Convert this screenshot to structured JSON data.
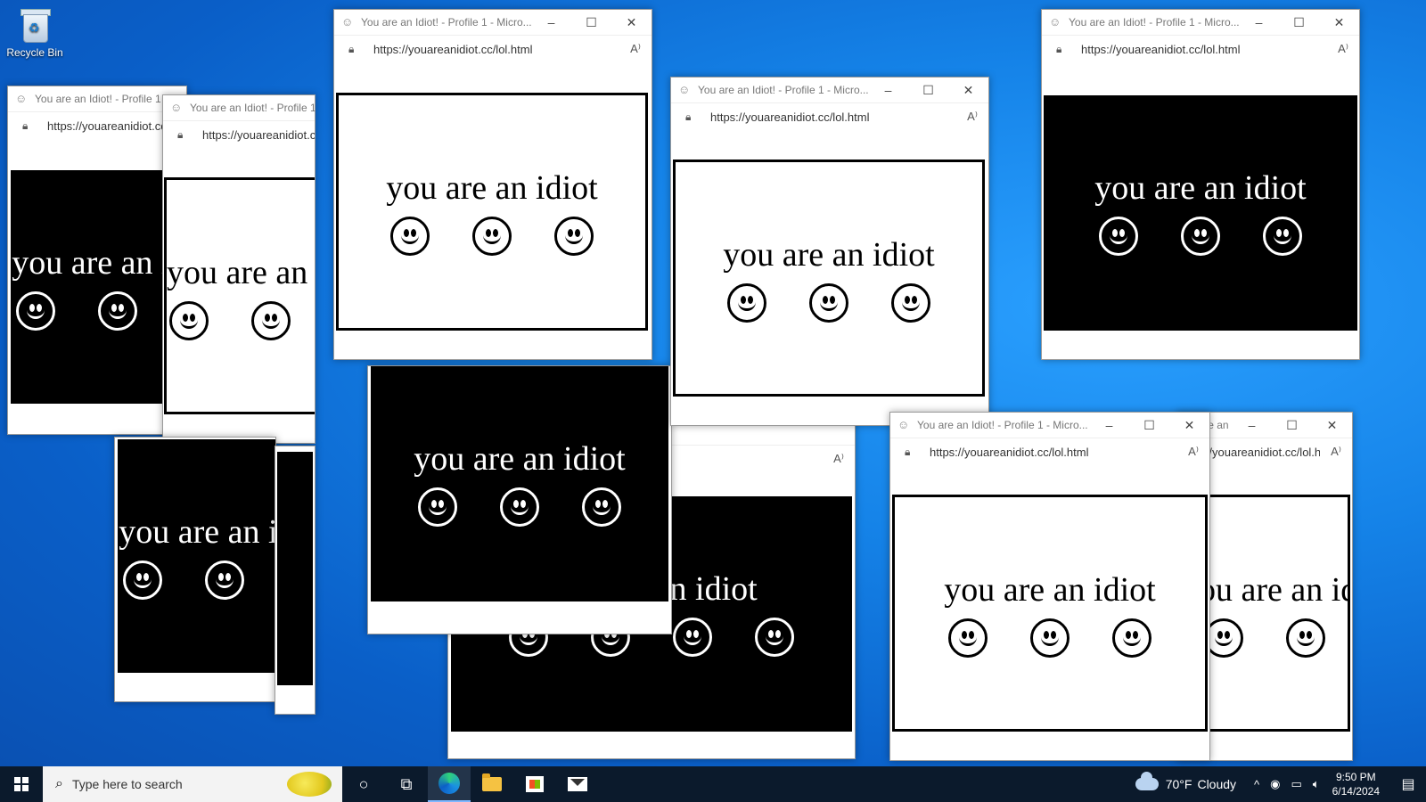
{
  "desktop": {
    "recycle_bin_label": "Recycle Bin"
  },
  "window_common": {
    "title": "You are an Idiot! - Profile 1 - Micro...",
    "url": "https://youareanidiot.cc/lol.html",
    "message": "you are an idiot",
    "minimize": "–",
    "maximize": "☐",
    "close": "✕"
  },
  "taskbar": {
    "search_placeholder": "Type here to search",
    "weather_temp": "70°F",
    "weather_cond": "Cloudy",
    "time": "9:50 PM",
    "date": "6/14/2024"
  },
  "colors": {
    "taskbar": "#0b1a2c",
    "desktop": "#1583e8",
    "panel_black": "#000000",
    "panel_white": "#ffffff"
  }
}
